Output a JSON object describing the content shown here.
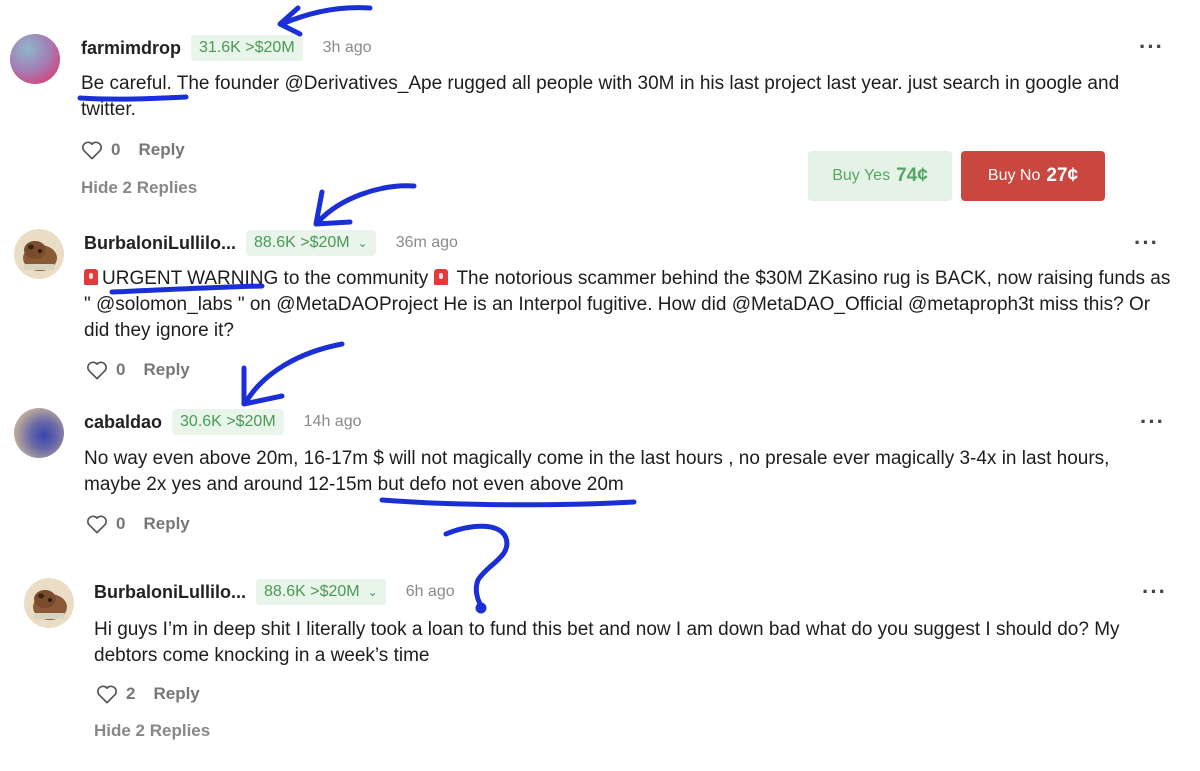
{
  "comments": [
    {
      "username": "farmimdrop",
      "badge": "31.6K >$20M",
      "time": "3h ago",
      "text_lead": "Be careful.",
      "text_rest": " The founder @Derivatives_Ape rugged all people with 30M in his last project last year. just search in google and twitter.",
      "likes": "0",
      "reply_label": "Reply",
      "hide_replies": "Hide 2 Replies"
    },
    {
      "username": "BurbaloniLullilo...",
      "badge": "88.6K >$20M",
      "time": "36m ago",
      "text_lead": "URGENT WARNING",
      "text_mid": " to the community ",
      "text_rest": " The notorious scammer behind the $30M ZKasino rug is BACK, now raising funds as \" @solomon_labs \" on @MetaDAOProject He is an Interpol fugitive. How did @MetaDAO_Official @metaproph3t miss this? Or did they ignore it?",
      "likes": "0",
      "reply_label": "Reply"
    },
    {
      "username": "cabaldao",
      "badge": "30.6K >$20M",
      "time": "14h ago",
      "text_lead": "No way even above 20m, 16-17m $ will not magically come in the last hours , no presale ever magically 3-4x in last hours, maybe 2x yes and around 12-15m ",
      "text_rest": "but defo not even above 20m",
      "likes": "0",
      "reply_label": "Reply"
    },
    {
      "username": "BurbaloniLullilo...",
      "badge": "88.6K >$20M",
      "time": "6h ago",
      "text": "Hi guys I’m in deep shit I literally took a loan to fund this bet and now I am down bad what do you suggest I should do? My debtors come knocking in a week’s time",
      "likes": "2",
      "reply_label": "Reply",
      "hide_replies": "Hide 2 Replies"
    }
  ],
  "trade": {
    "yes_label": "Buy Yes",
    "yes_price": "74¢",
    "no_label": "Buy No",
    "no_price": "27¢"
  },
  "more_icon": "more-horizontal-icon",
  "colors": {
    "badge_bg": "#e9f4ea",
    "badge_text": "#4a9a57",
    "buy_no_bg": "#c9473f",
    "buy_yes_bg": "#e4f3e6",
    "annotation_ink": "#1b2fd6"
  }
}
